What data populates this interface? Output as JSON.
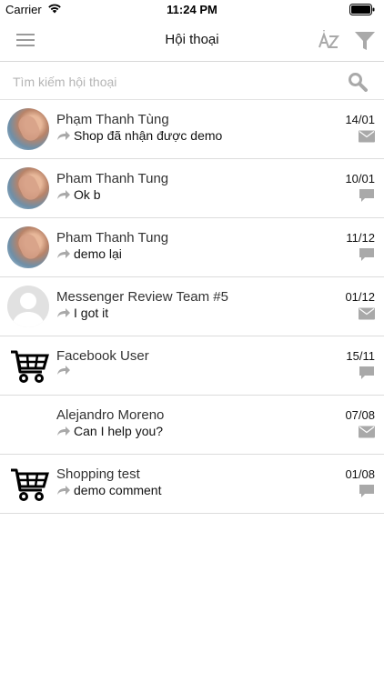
{
  "status_bar": {
    "carrier": "Carrier",
    "time": "11:24 PM"
  },
  "nav": {
    "title": "Hội thoại",
    "menu_icon": "hamburger-icon",
    "sort_icon": "sort-az-icon",
    "filter_icon": "filter-icon"
  },
  "search": {
    "placeholder": "Tìm kiếm hội thoại",
    "value": ""
  },
  "conversations": [
    {
      "name": "Phạm Thanh Tùng",
      "message": "Shop đã nhận được demo",
      "date": "14/01",
      "avatar": "photo",
      "type": "mail"
    },
    {
      "name": "Pham Thanh Tung",
      "message": "Ok b",
      "date": "10/01",
      "avatar": "photo",
      "type": "comment"
    },
    {
      "name": "Pham Thanh Tung",
      "message": "demo lại",
      "date": "11/12",
      "avatar": "photo",
      "type": "comment"
    },
    {
      "name": "Messenger Review Team #5",
      "message": "I got it",
      "date": "01/12",
      "avatar": "default",
      "type": "mail"
    },
    {
      "name": "Facebook User",
      "message": "",
      "date": "15/11",
      "avatar": "cart",
      "type": "comment"
    },
    {
      "name": "Alejandro Moreno",
      "message": "Can I help you?",
      "date": "07/08",
      "avatar": "none",
      "type": "mail"
    },
    {
      "name": "Shopping test",
      "message": "demo comment",
      "date": "01/08",
      "avatar": "cart",
      "type": "comment"
    }
  ],
  "colors": {
    "icon_gray": "#a9a9a9",
    "divider": "#dcdcdc",
    "text": "#333333"
  }
}
